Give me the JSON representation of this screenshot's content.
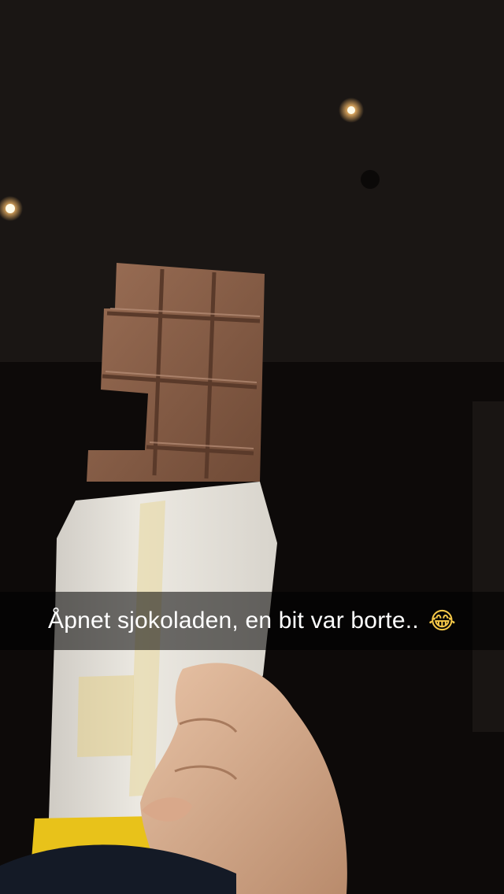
{
  "snap": {
    "caption": "Åpnet sjokoladen, en bit var borte..",
    "caption_emoji": "😂",
    "caption_emoji_name": "face-with-tears-of-joy"
  },
  "colors": {
    "caption_bar": "#000000",
    "caption_text": "#ffffff",
    "chocolate": "#8a6048",
    "wrapper": "#e9e6df",
    "foil": "#e8c21a"
  }
}
